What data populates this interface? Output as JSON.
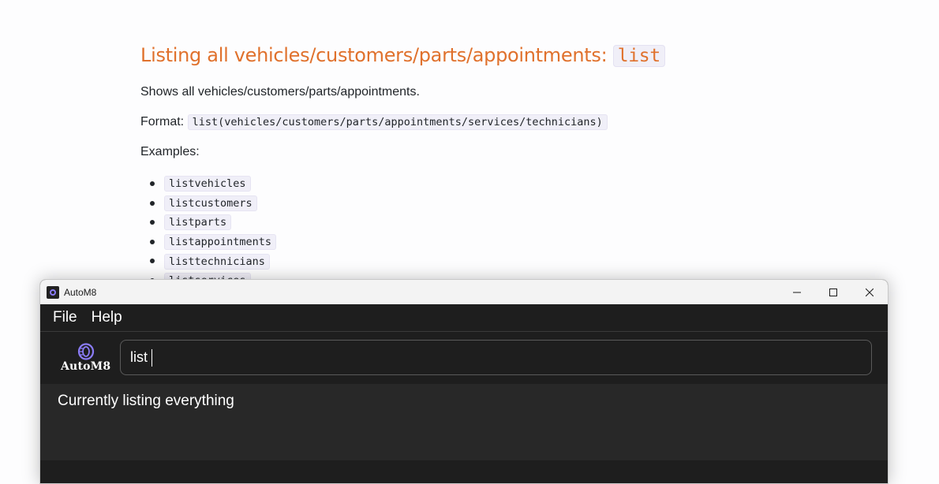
{
  "doc": {
    "heading": "Listing all vehicles/customers/parts/appointments: ",
    "heading_code": "list",
    "description": "Shows all vehicles/customers/parts/appointments.",
    "format_label": "Format: ",
    "format_code": "list(vehicles/customers/parts/appointments/services/technicians)",
    "examples_label": "Examples:",
    "examples": [
      "listvehicles",
      "listcustomers",
      "listparts",
      "listappointments",
      "listtechnicians",
      "listservices"
    ]
  },
  "window": {
    "title": "AutoM8",
    "menu": [
      "File",
      "Help"
    ],
    "logo_text": "AutoM8",
    "command_value": "list",
    "result_text": "Currently listing everything",
    "accent_color": "#8b7cf7"
  }
}
